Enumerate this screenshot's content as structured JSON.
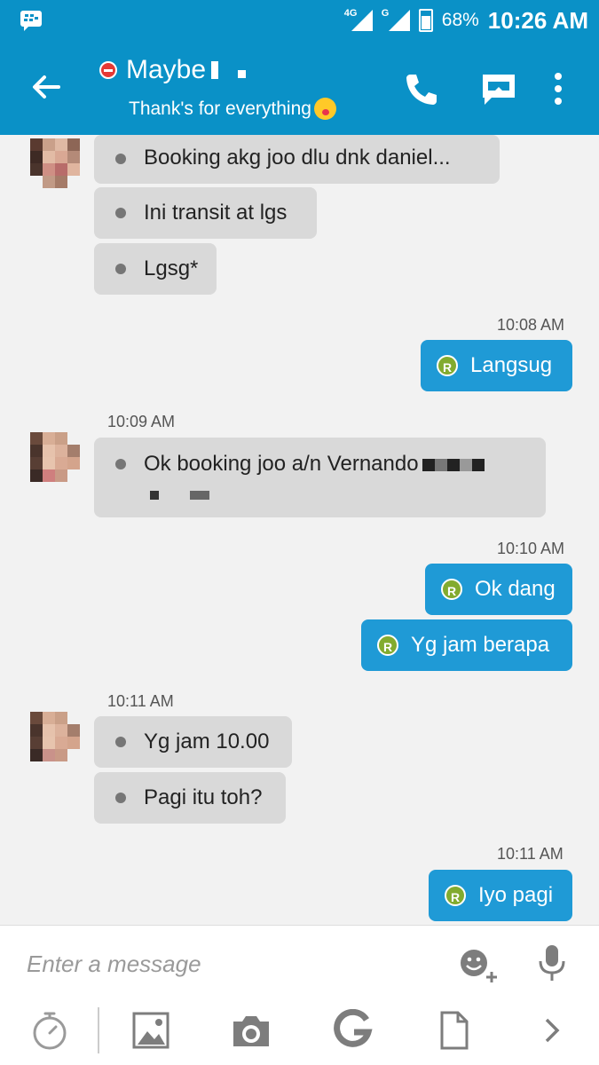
{
  "status_bar": {
    "network_1": "4G",
    "network_2": "G",
    "battery": "68%",
    "time": "10:26 AM"
  },
  "header": {
    "contact_name": "Maybe",
    "status_message": "Thank's for everything"
  },
  "messages": {
    "m1": "Booking akg joo dlu dnk daniel...",
    "m2": "Ini transit at lgs",
    "m3": "Lgsg*",
    "t1": "10:08 AM",
    "m4": "Langsug",
    "t2": "10:09 AM",
    "m5": "Ok booking joo a/n Vernando",
    "t3": "10:10 AM",
    "m6": "Ok dang",
    "m7": "Yg jam berapa",
    "t4": "10:11 AM",
    "m8": "Yg jam 10.00",
    "m9": "Pagi itu toh?",
    "t5": "10:11 AM",
    "m10": "Iyo pagi"
  },
  "sent_badge": "R",
  "composer": {
    "placeholder": "Enter a message"
  },
  "colors": {
    "primary": "#0a91c7",
    "sent_bubble": "#1f9ad6",
    "received_bubble": "#d9d9d9",
    "badge": "#82ab2f"
  },
  "icons": [
    "bbm-icon",
    "back-arrow-icon",
    "phone-icon",
    "video-chat-icon",
    "more-vert-icon",
    "emoji-add-icon",
    "mic-icon",
    "timer-icon",
    "image-icon",
    "camera-icon",
    "google-icon",
    "file-icon",
    "chevron-right-icon"
  ]
}
